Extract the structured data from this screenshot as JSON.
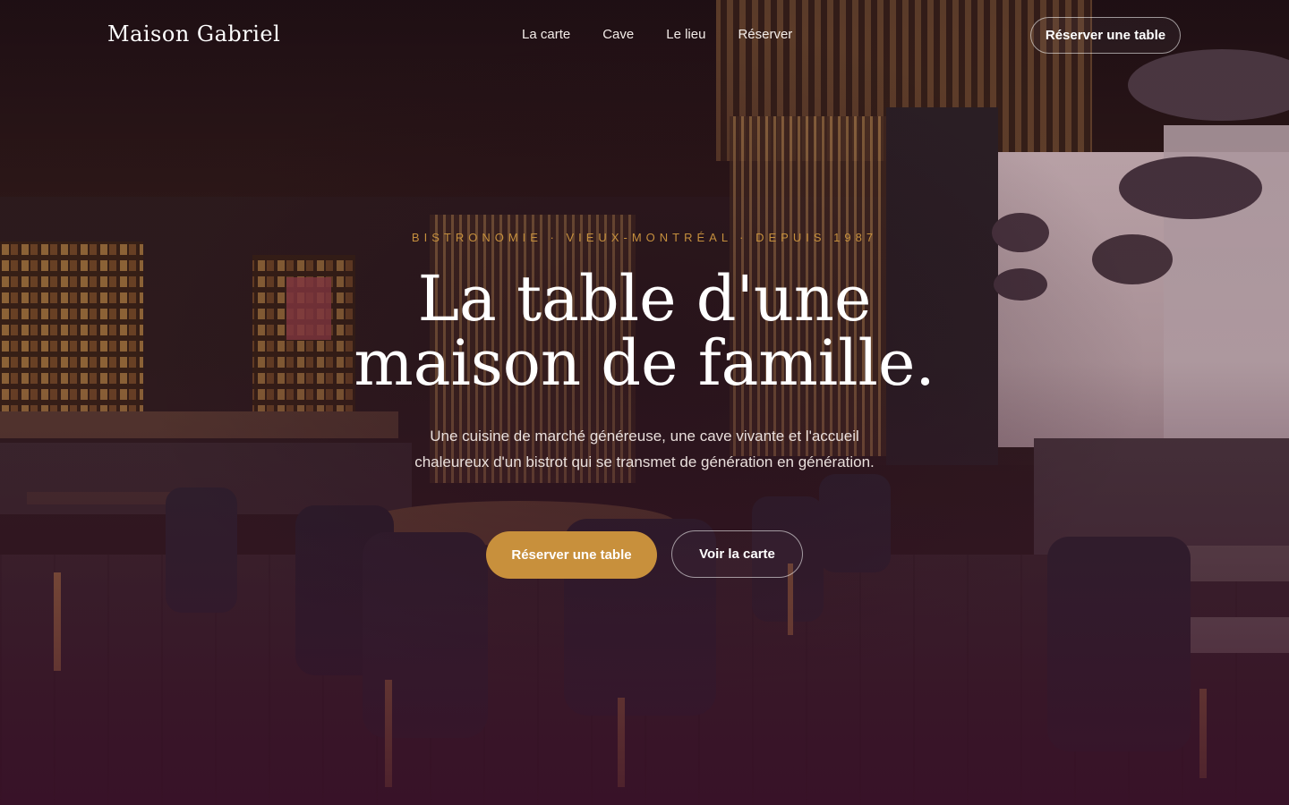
{
  "header": {
    "brand": "Maison Gabriel",
    "nav": [
      {
        "label": "La carte"
      },
      {
        "label": "Cave"
      },
      {
        "label": "Le lieu"
      },
      {
        "label": "Réserver"
      }
    ],
    "cta_label": "Réserver une table"
  },
  "hero": {
    "eyebrow": "BISTRONOMIE · VIEUX-MONTRÉAL · DEPUIS 1987",
    "headline_line1": "La table d'une",
    "headline_line2": "maison de famille.",
    "subtitle": "Une cuisine de marché généreuse, une cave vivante et l'accueil chaleureux d'un bistrot qui se transmet de génération en génération.",
    "primary_button": "Réserver une table",
    "secondary_button": "Voir la carte",
    "background_image": "restaurant-interior-photo"
  },
  "colors": {
    "accent": "#c8903c",
    "eyebrow": "#c58f3d",
    "overlay": "#3a1028"
  }
}
